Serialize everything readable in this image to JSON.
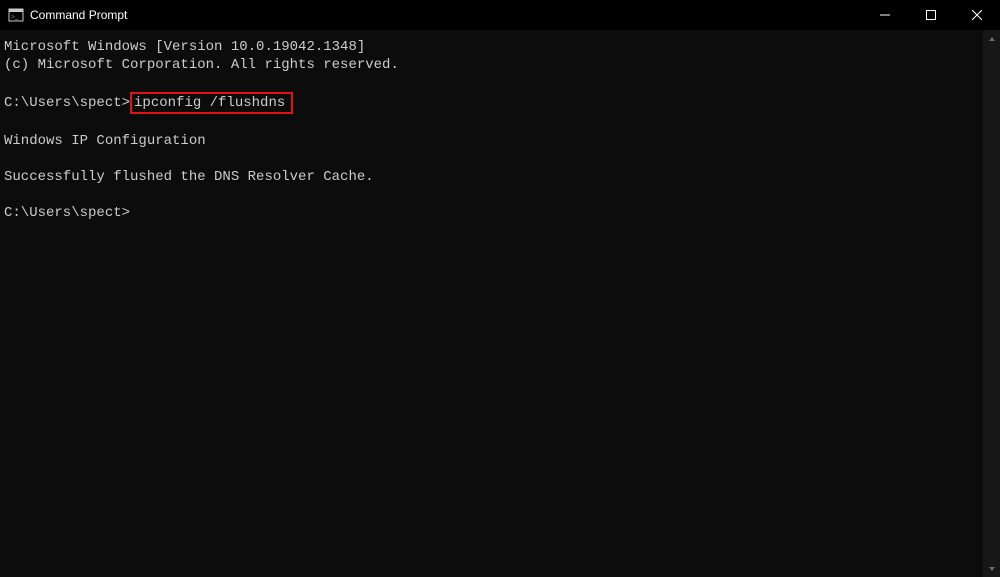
{
  "titlebar": {
    "title": "Command Prompt"
  },
  "console": {
    "line1": "Microsoft Windows [Version 10.0.19042.1348]",
    "line2": "(c) Microsoft Corporation. All rights reserved.",
    "prompt1_prefix": "C:\\Users\\spect>",
    "prompt1_cmd": "ipconfig /flushdns",
    "heading": "Windows IP Configuration",
    "result": "Successfully flushed the DNS Resolver Cache.",
    "prompt2": "C:\\Users\\spect>"
  }
}
